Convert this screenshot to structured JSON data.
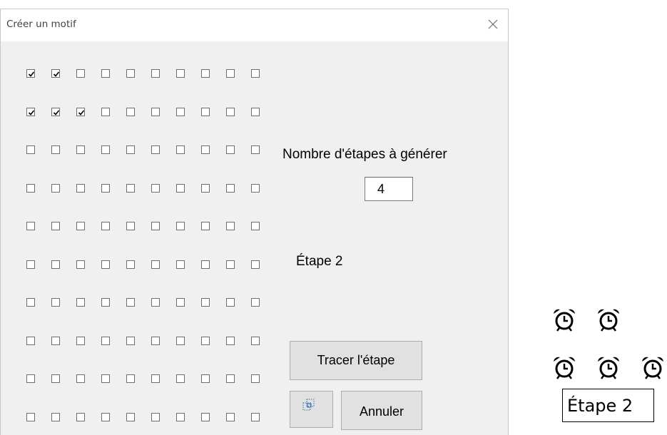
{
  "dialog": {
    "title": "Créer un motif",
    "close_icon": "close-icon"
  },
  "grid": {
    "rows": 10,
    "cols": 10,
    "checked": [
      [
        true,
        true,
        false,
        false,
        false,
        false,
        false,
        false,
        false,
        false
      ],
      [
        true,
        true,
        true,
        false,
        false,
        false,
        false,
        false,
        false,
        false
      ],
      [
        false,
        false,
        false,
        false,
        false,
        false,
        false,
        false,
        false,
        false
      ],
      [
        false,
        false,
        false,
        false,
        false,
        false,
        false,
        false,
        false,
        false
      ],
      [
        false,
        false,
        false,
        false,
        false,
        false,
        false,
        false,
        false,
        false
      ],
      [
        false,
        false,
        false,
        false,
        false,
        false,
        false,
        false,
        false,
        false
      ],
      [
        false,
        false,
        false,
        false,
        false,
        false,
        false,
        false,
        false,
        false
      ],
      [
        false,
        false,
        false,
        false,
        false,
        false,
        false,
        false,
        false,
        false
      ],
      [
        false,
        false,
        false,
        false,
        false,
        false,
        false,
        false,
        false,
        false
      ],
      [
        false,
        false,
        false,
        false,
        false,
        false,
        false,
        false,
        false,
        false
      ]
    ]
  },
  "steps": {
    "label": "Nombre d'étapes à générer",
    "value": "4"
  },
  "current_step_label": "Étape 2",
  "buttons": {
    "trace": "Tracer l'étape",
    "icon": "copy-selection-icon",
    "cancel": "Annuler"
  },
  "output": {
    "rows": [
      2,
      3
    ],
    "icon": "alarm-clock-icon",
    "label": "Étape 2"
  }
}
